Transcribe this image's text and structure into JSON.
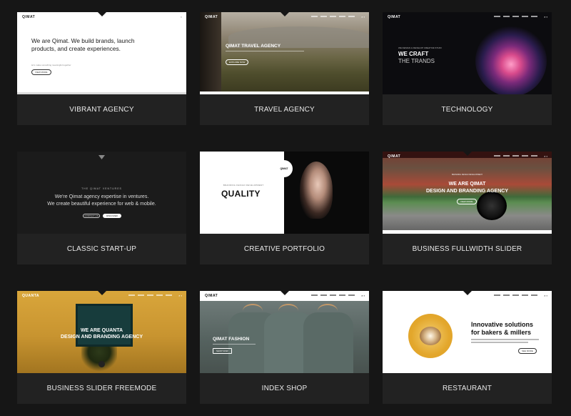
{
  "cards": [
    {
      "caption": "VIBRANT AGENCY",
      "logo": "QIMAT",
      "headline": "We are Qimat. We build brands, launch products, and create experiences.",
      "subtext": "let's make something meaningful together",
      "button": "VIEW MORE"
    },
    {
      "caption": "TRAVEL AGENCY",
      "logo": "QIMAT",
      "headline": "QIMAT TRAVEL AGENCY",
      "button": "EXPLORE NOW"
    },
    {
      "caption": "TECHNOLOGY",
      "logo": "QIMAT",
      "kicker": "WE DESIGN & DEVELOP CREATIVE STUFF",
      "headline1": "WE CRAFT",
      "headline2": "THE TRANDS"
    },
    {
      "caption": "CLASSIC START-UP",
      "kicker": "THE QIMAT VENTURES",
      "line1": "We're Qimat agency expertise in ventures.",
      "line2": "We create beautiful experience for web & mobile.",
      "button1": "CONTACT US",
      "button2": "DISCOVER"
    },
    {
      "caption": "CREATIVE PORTFOLIO",
      "logo": "QIMAT",
      "tags": "BRANDING  DESIGN  DEVELOPMENT",
      "headline": "QUALITY"
    },
    {
      "caption": "BUSINESS FULLWIDTH SLIDER",
      "logo": "QIMAT",
      "kicker": "BRANDING  DESIGN  DEVELOPMENT",
      "headline1": "WE ARE QIMAT",
      "headline2": "DESIGN AND BRANDING AGENCY",
      "button": "VIEW MORE"
    },
    {
      "caption": "BUSINESS SLIDER FREEMODE",
      "logo": "QUANTA",
      "headline1": "WE ARE QUANTA",
      "headline2": "DESIGN AND BRANDING AGENCY"
    },
    {
      "caption": "INDEX SHOP",
      "logo": "QIMAT",
      "headline": "QIMAT FASHION",
      "button": "SHOP NOW"
    },
    {
      "caption": "RESTAURANT",
      "headline1": "Innovative solutions",
      "headline2": "for bakers & millers",
      "button": "SEE MORE"
    }
  ],
  "icons": {
    "search": "search-icon",
    "cart": "cart-icon",
    "menu": "menu-icon"
  },
  "colors": {
    "background": "#161616",
    "caption_bg": "#222222",
    "caption_text": "#e8e8e8"
  }
}
